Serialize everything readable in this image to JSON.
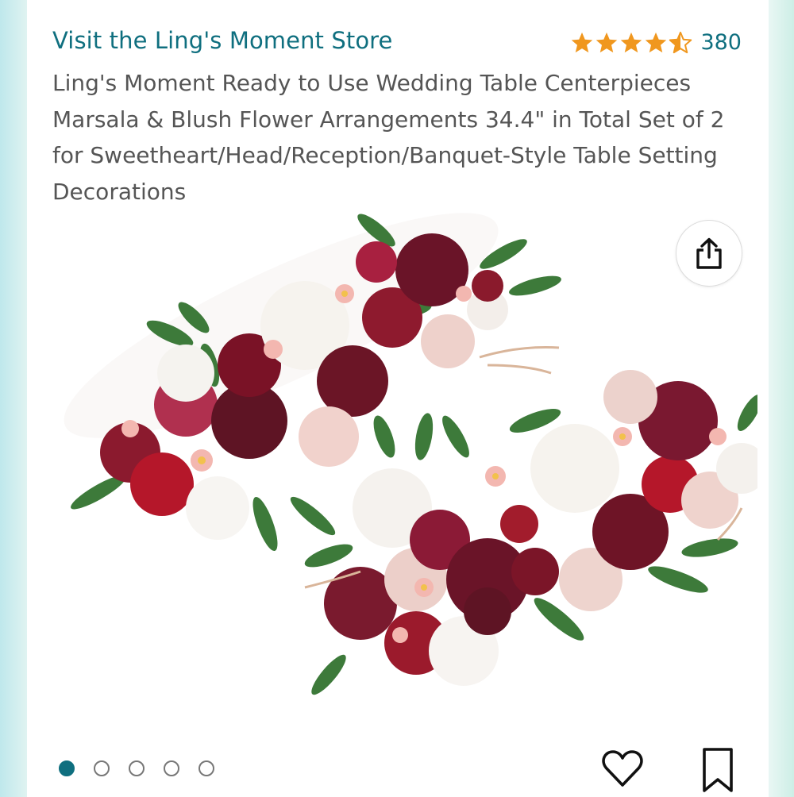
{
  "store": {
    "link_text": "Visit the Ling's Moment Store"
  },
  "rating": {
    "stars": 4.5,
    "review_count": "380",
    "star_color": "#f0971e"
  },
  "product": {
    "title": "Ling's Moment Ready to Use Wedding Table Centerpieces Marsala & Blush Flower Arrangements 34.4\" in Total Set of 2 for Sweetheart/Head/Reception/Banquet-Style Table Setting Decorations",
    "image_alt": "Two marsala and blush flower arrangement centerpieces with white peonies, burgundy roses and green leaves"
  },
  "gallery": {
    "total_images": 5,
    "active_index": 0
  },
  "icons": {
    "share": "share-icon",
    "like": "heart-icon",
    "save": "bookmark-icon"
  },
  "colors": {
    "accent": "#0f6f7f",
    "text": "#555555"
  }
}
